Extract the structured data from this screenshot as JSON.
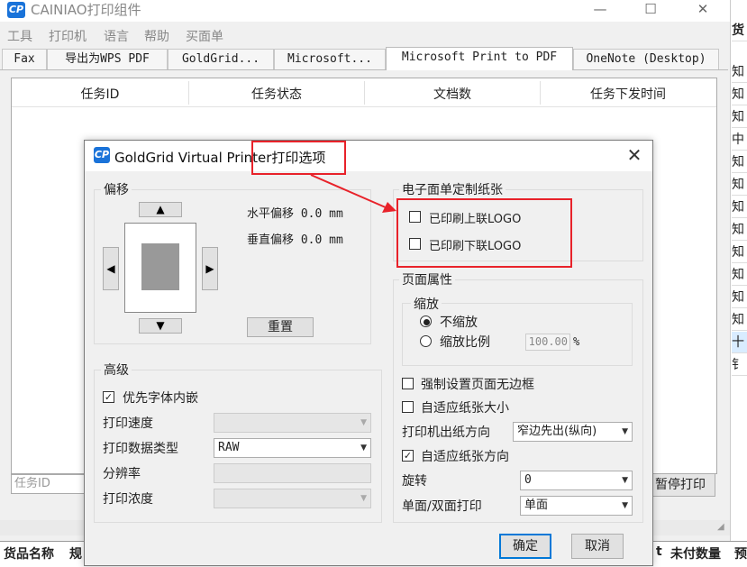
{
  "app": {
    "title": "CAINIAO打印组件",
    "logo_text": "CP"
  },
  "menu": [
    "工具",
    "打印机",
    "语言",
    "帮助",
    "买面单"
  ],
  "tabs": [
    "Fax",
    "导出为WPS PDF",
    "GoldGrid...",
    "Microsoft...",
    "Microsoft Print to PDF",
    "OneNote (Desktop)"
  ],
  "table": {
    "headers": [
      "任务ID",
      "任务状态",
      "文档数",
      "任务下发时间"
    ]
  },
  "footer": {
    "taskid_placeholder": "任务ID",
    "pause_label": "暂停打印"
  },
  "right_column": [
    "货",
    "知",
    "知",
    "知",
    "中",
    "知",
    "知",
    "知",
    "知",
    "知",
    "知",
    "知",
    "知",
    "知",
    "十",
    "钅"
  ],
  "bottom_headers": [
    "货品名称",
    "规",
    "t",
    "未付数量",
    "预"
  ],
  "dialog": {
    "title": "GoldGrid Virtual Printer打印选项",
    "offset": {
      "title": "偏移",
      "horizontal": "水平偏移 0.0 mm",
      "vertical": "垂直偏移 0.0 mm",
      "reset_label": "重置"
    },
    "advanced": {
      "title": "高级",
      "prefer_font_embed": "优先字体内嵌",
      "print_speed_label": "打印速度",
      "data_type_label": "打印数据类型",
      "data_type_value": "RAW",
      "resolution_label": "分辨率",
      "density_label": "打印浓度"
    },
    "custom_paper": {
      "title": "电子面单定制纸张",
      "upper_logo": "已印刷上联LOGO",
      "lower_logo": "已印刷下联LOGO"
    },
    "page": {
      "title": "页面属性",
      "zoom_title": "缩放",
      "no_zoom": "不缩放",
      "zoom_ratio": "缩放比例",
      "zoom_value": "100.00",
      "zoom_unit": "%",
      "force_borderless": "强制设置页面无边框",
      "fit_paper_size": "自适应纸张大小",
      "feed_direction_label": "打印机出纸方向",
      "feed_direction_value": "窄边先出(纵向)",
      "fit_paper_orientation": "自适应纸张方向",
      "rotate_label": "旋转",
      "rotate_value": "0",
      "duplex_label": "单面/双面打印",
      "duplex_value": "单面"
    },
    "ok_label": "确定",
    "cancel_label": "取消"
  },
  "colors": {
    "annotation": "#e8222a",
    "accent": "#0078d7",
    "logo": "#1a73d9"
  }
}
